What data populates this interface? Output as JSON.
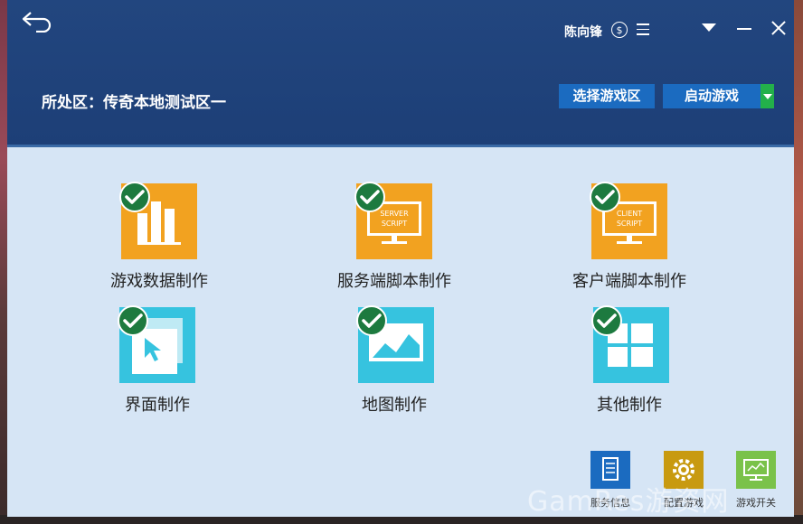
{
  "header": {
    "user_name": "陈向锋",
    "coin_symbol": "$",
    "zone_text": "所处区：传奇本地测试区一",
    "select_zone_label": "选择游戏区",
    "start_game_label": "启动游戏"
  },
  "tiles": [
    {
      "label": "游戏数据制作",
      "icon": "bar-chart-icon",
      "color": "#f2a220"
    },
    {
      "label": "服务端脚本制作",
      "icon": "server-script-icon",
      "monitor_text": [
        "SERVER",
        "SCRIPT"
      ],
      "color": "#f2a220"
    },
    {
      "label": "客户端脚本制作",
      "icon": "client-script-icon",
      "monitor_text": [
        "CLIENT",
        "SCRIPT"
      ],
      "color": "#f2a220"
    },
    {
      "label": "界面制作",
      "icon": "ui-cursor-icon",
      "color": "#36c3df"
    },
    {
      "label": "地图制作",
      "icon": "map-image-icon",
      "color": "#36c3df"
    },
    {
      "label": "其他制作",
      "icon": "windows-grid-icon",
      "color": "#36c3df"
    }
  ],
  "bottom_buttons": [
    {
      "label": "服务信息",
      "icon": "document-icon",
      "color": "#1b6bc0"
    },
    {
      "label": "配置游戏",
      "icon": "gear-icon",
      "color": "#c89a10"
    },
    {
      "label": "游戏开关",
      "icon": "monitor-icon",
      "color": "#7ac24a"
    }
  ],
  "watermark": "GamRes游资网"
}
